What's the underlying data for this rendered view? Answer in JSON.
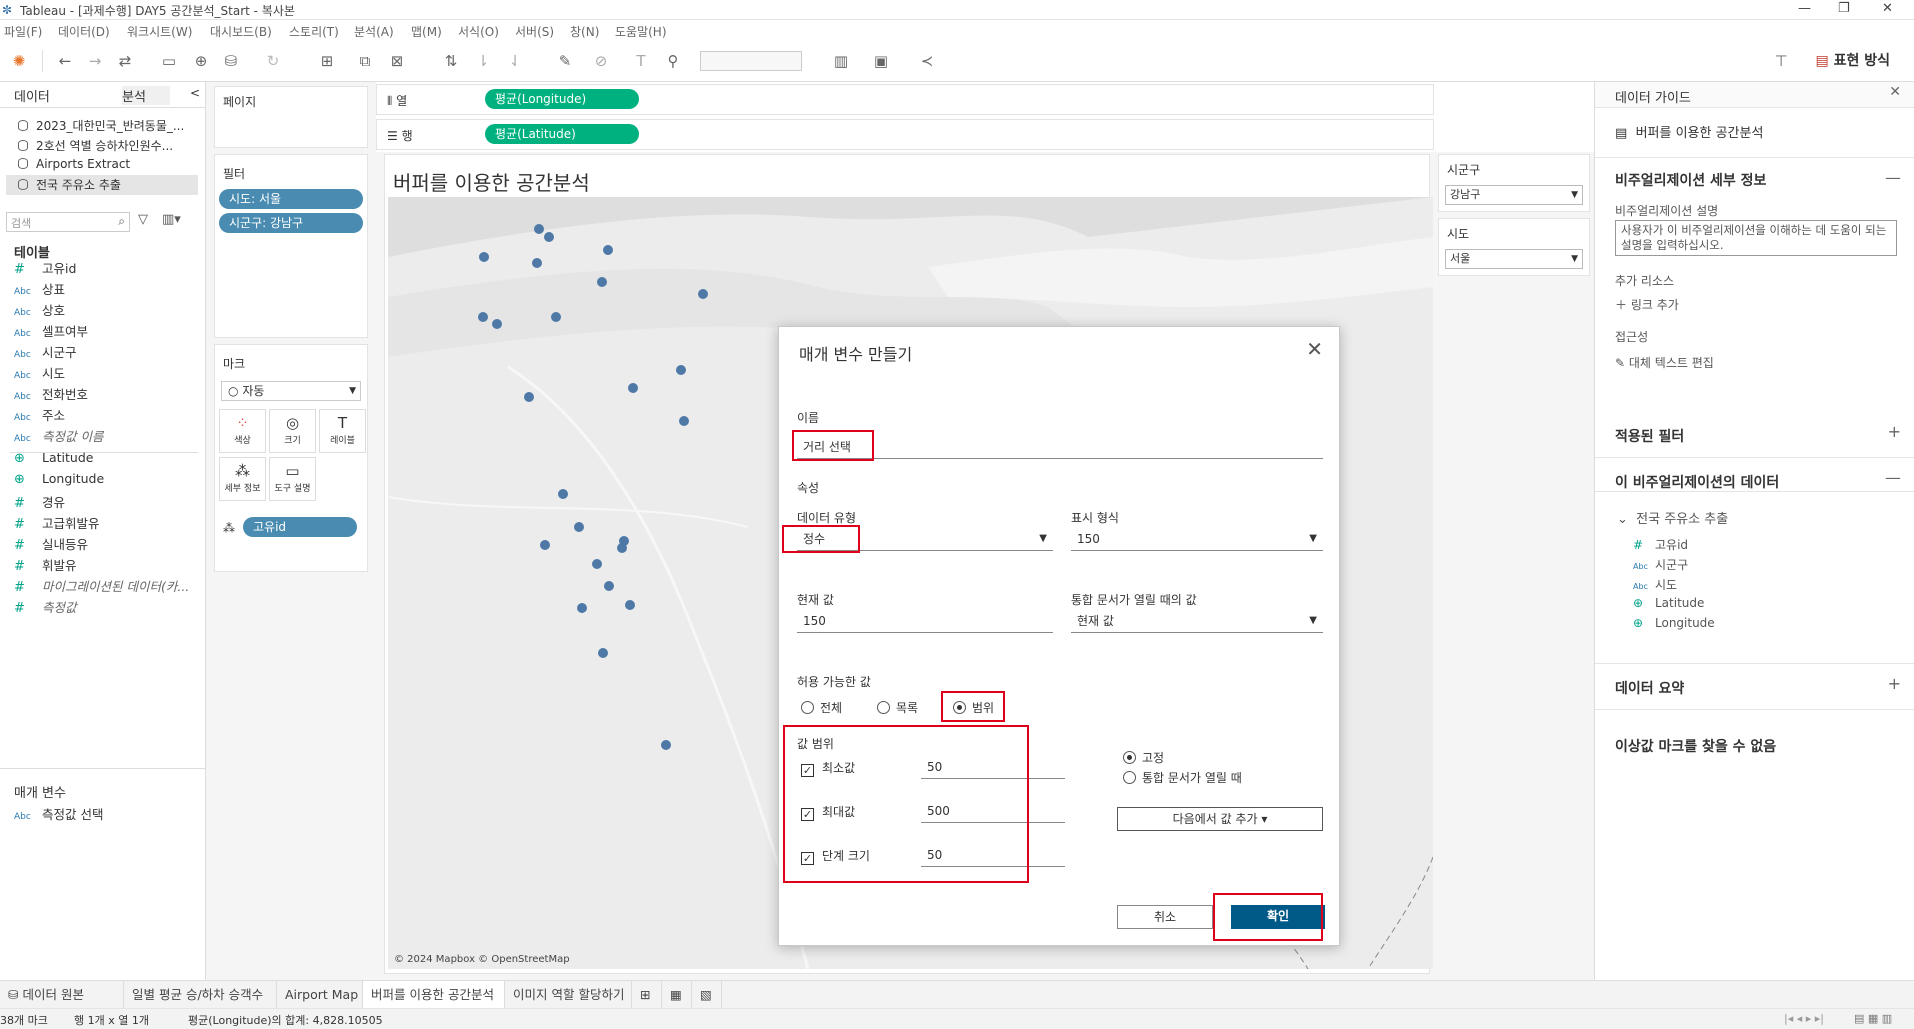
{
  "window": {
    "title": "Tableau - [과제수행] DAY5 공간분석_Start - 복사본",
    "controls": [
      "—",
      "❐",
      "✕"
    ]
  },
  "menu": [
    "파일(F)",
    "데이터(D)",
    "워크시트(W)",
    "대시보드(B)",
    "스토리(T)",
    "분석(A)",
    "맵(M)",
    "서식(O)",
    "서버(S)",
    "창(N)",
    "도움말(H)"
  ],
  "toolbar": {
    "show_me_label": "표현 방식"
  },
  "data_pane": {
    "tabs": [
      "데이터",
      "분석"
    ],
    "datasources": [
      "2023_대한민국_반려동물_...",
      "2호선 역별 승하차인원수...",
      "Airports Extract",
      "전국 주유소 추출"
    ],
    "search_placeholder": "검색",
    "tables_label": "테이블",
    "fields": [
      {
        "type": "#",
        "name": "고유id",
        "kind": "num"
      },
      {
        "type": "Abc",
        "name": "상표",
        "kind": "str"
      },
      {
        "type": "Abc",
        "name": "상호",
        "kind": "str"
      },
      {
        "type": "Abc",
        "name": "셀프여부",
        "kind": "str"
      },
      {
        "type": "Abc",
        "name": "시군구",
        "kind": "str"
      },
      {
        "type": "Abc",
        "name": "시도",
        "kind": "str"
      },
      {
        "type": "Abc",
        "name": "전화번호",
        "kind": "str"
      },
      {
        "type": "Abc",
        "name": "주소",
        "kind": "str"
      },
      {
        "type": "Abc",
        "name": "측정값 이름",
        "kind": "str",
        "italic": true
      },
      {
        "type": "⊕",
        "name": "Latitude",
        "kind": "geo"
      },
      {
        "type": "⊕",
        "name": "Longitude",
        "kind": "geo"
      },
      {
        "type": "#",
        "name": "경유",
        "kind": "num"
      },
      {
        "type": "#",
        "name": "고급휘발유",
        "kind": "num"
      },
      {
        "type": "#",
        "name": "실내등유",
        "kind": "num"
      },
      {
        "type": "#",
        "name": "휘발유",
        "kind": "num"
      },
      {
        "type": "#",
        "name": "마이그레이션된 데이터(카...",
        "kind": "num",
        "italic": true
      },
      {
        "type": "#",
        "name": "측정값",
        "kind": "num",
        "italic": true
      }
    ],
    "params_label": "매개 변수",
    "params": [
      {
        "type": "Abc",
        "name": "측정값 선택"
      }
    ]
  },
  "shelves": {
    "pages_label": "페이지",
    "filters_label": "필터",
    "filter_pills": [
      "시도: 서울",
      "시군구: 강남구"
    ],
    "marks_label": "마크",
    "mark_type": "자동",
    "mark_buttons": [
      "색상",
      "크기",
      "레이블",
      "세부 정보",
      "도구 설명"
    ],
    "mark_pill": "고유id",
    "columns_label": "열",
    "columns_pill": "평균(Longitude)",
    "rows_label": "행",
    "rows_pill": "평균(Latitude)"
  },
  "view": {
    "title": "버퍼를 이용한 공간분석",
    "attribution": "© 2024 Mapbox © OpenStreetMap",
    "dot_color": "#4e79a7"
  },
  "filter_cards": [
    {
      "title": "시군구",
      "value": "강남구"
    },
    {
      "title": "시도",
      "value": "서울"
    }
  ],
  "data_guide": {
    "header": "데이터 가이드",
    "sheet_name": "버퍼를 이용한 공간분석",
    "viz_details": "비주얼리제이션 세부 정보",
    "viz_desc_label": "비주얼리제이션 설명",
    "viz_desc_placeholder": "사용자가 이 비주얼리제이션을 이해하는 데 도움이 되는 설명을 입력하십시오.",
    "extra_resources": "추가 리소스",
    "add_link": "링크 추가",
    "accessibility": "접근성",
    "alt_text": "대체 텍스트 편집",
    "applied_filters": "적용된 필터",
    "viz_data": "이 비주얼리제이션의 데이터",
    "datasource": "전국 주유소 추출",
    "data_fields": [
      {
        "type": "#",
        "name": "고유id"
      },
      {
        "type": "Abc",
        "name": "시군구"
      },
      {
        "type": "Abc",
        "name": "시도"
      },
      {
        "type": "⊕",
        "name": "Latitude"
      },
      {
        "type": "⊕",
        "name": "Longitude"
      }
    ],
    "data_summary": "데이터 요약",
    "no_outliers": "이상값 마크를 찾을 수 없음"
  },
  "dialog": {
    "title": "매개 변수 만들기",
    "name_label": "이름",
    "name_value": "거리 선택",
    "properties_label": "속성",
    "data_type_label": "데이터 유형",
    "data_type_value": "정수",
    "display_format_label": "표시 형식",
    "display_format_value": "150",
    "current_value_label": "현재 값",
    "current_value": "150",
    "workbook_open_label": "통합 문서가 열릴 때의 값",
    "workbook_open_value": "현재 값",
    "allowable_label": "허용 가능한 값",
    "allowable_options": [
      "전체",
      "목록",
      "범위"
    ],
    "allowable_selected": "범위",
    "range_label": "값 범위",
    "min_label": "최소값",
    "min_value": "50",
    "max_label": "최대값",
    "max_value": "500",
    "step_label": "단계 크기",
    "step_value": "50",
    "fixed_label": "고정",
    "on_open_label": "통합 문서가 열릴 때",
    "add_values_label": "다음에서 값 추가 ▾",
    "cancel_label": "취소",
    "ok_label": "확인",
    "ok_color": "#005a87",
    "highlight_color": "#e0001b"
  },
  "sheet_tabs": [
    "데이터 원본",
    "일별 평균 승/하차 승객수",
    "Airport Map",
    "버퍼를 이용한 공간분석",
    "이미지 역할 할당하기"
  ],
  "active_tab": "버퍼를 이용한 공간분석",
  "status": {
    "marks": "38개 마크",
    "rows_cols": "행 1개 x 열 1개",
    "sum": "평균(Longitude)의 합계: 4,828.10505"
  }
}
